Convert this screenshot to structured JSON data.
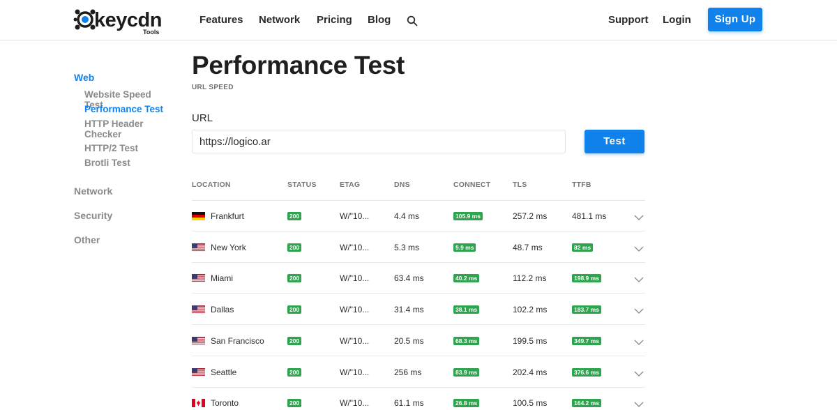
{
  "header": {
    "logo_text": "keycdn",
    "logo_sub": "Tools",
    "nav": [
      "Features",
      "Network",
      "Pricing",
      "Blog"
    ],
    "support": "Support",
    "login": "Login",
    "signup": "Sign Up"
  },
  "sidebar": {
    "categories": [
      "Web",
      "Network",
      "Security",
      "Other"
    ],
    "web_items": [
      "Website Speed Test",
      "Performance Test",
      "HTTP Header Checker",
      "HTTP/2 Test",
      "Brotli Test"
    ]
  },
  "main": {
    "title": "Performance Test",
    "subtitle": "URL SPEED",
    "url_label": "URL",
    "url_value": "https://logico.ar",
    "test_button": "Test"
  },
  "table": {
    "headers": [
      "LOCATION",
      "STATUS",
      "ETAG",
      "DNS",
      "CONNECT",
      "TLS",
      "TTFB"
    ],
    "rows": [
      {
        "location": "Frankfurt",
        "flag": "de",
        "status": "200",
        "etag": "W/\"10...",
        "dns": "4.4 ms",
        "connect": "105.9 ms",
        "connect_badge": true,
        "tls": "257.2 ms",
        "ttfb": "481.1 ms",
        "ttfb_badge": false
      },
      {
        "location": "New York",
        "flag": "us",
        "status": "200",
        "etag": "W/\"10...",
        "dns": "5.3 ms",
        "connect": "9.9 ms",
        "connect_badge": true,
        "tls": "48.7 ms",
        "ttfb": "82 ms",
        "ttfb_badge": true
      },
      {
        "location": "Miami",
        "flag": "us",
        "status": "200",
        "etag": "W/\"10...",
        "dns": "63.4 ms",
        "connect": "40.2 ms",
        "connect_badge": true,
        "tls": "112.2 ms",
        "ttfb": "198.9 ms",
        "ttfb_badge": true
      },
      {
        "location": "Dallas",
        "flag": "us",
        "status": "200",
        "etag": "W/\"10...",
        "dns": "31.4 ms",
        "connect": "38.1 ms",
        "connect_badge": true,
        "tls": "102.2 ms",
        "ttfb": "183.7 ms",
        "ttfb_badge": true
      },
      {
        "location": "San Francisco",
        "flag": "us",
        "status": "200",
        "etag": "W/\"10...",
        "dns": "20.5 ms",
        "connect": "68.3 ms",
        "connect_badge": true,
        "tls": "199.5 ms",
        "ttfb": "349.7 ms",
        "ttfb_badge": true
      },
      {
        "location": "Seattle",
        "flag": "us",
        "status": "200",
        "etag": "W/\"10...",
        "dns": "256 ms",
        "connect": "83.9 ms",
        "connect_badge": true,
        "tls": "202.4 ms",
        "ttfb": "376.6 ms",
        "ttfb_badge": true
      },
      {
        "location": "Toronto",
        "flag": "ca",
        "status": "200",
        "etag": "W/\"10...",
        "dns": "61.1 ms",
        "connect": "26.8 ms",
        "connect_badge": true,
        "tls": "100.5 ms",
        "ttfb": "164.2 ms",
        "ttfb_badge": true
      }
    ]
  },
  "colors": {
    "accent": "#1182ec",
    "badge_green": "#2ea44f"
  }
}
